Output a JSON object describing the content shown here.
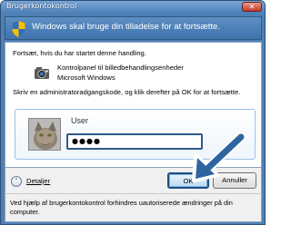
{
  "window": {
    "title": "Brugerkontokontrol",
    "close_glyph": "✕"
  },
  "banner": {
    "text": "Windows skal bruge din tilladelse for at fortsætte."
  },
  "body": {
    "intro": "Fortsæt, hvis du har startet denne handling.",
    "program_name": "Kontrolpanel til billedbehandlingsenheder",
    "publisher": "Microsoft Windows",
    "prompt": "Skriv en administratoradgangskode, og klik derefter på OK for at fortsætte."
  },
  "credential": {
    "user_label": "User",
    "password_value": "●●●●"
  },
  "actions": {
    "details_label": "Detaljer",
    "ok_label": "OK",
    "cancel_label": "Annuller"
  },
  "footer": {
    "text": "Ved hjælp af brugerkontokontrol forhindres uautoriserede ændringer på din computer."
  },
  "colors": {
    "frame": "#4f7fb3",
    "banner": "#3f73ab",
    "highlight_arrow": "#2e64a0",
    "ok_border": "#1d4f82"
  },
  "icons": [
    "shield-icon",
    "control-panel-icon",
    "user-avatar",
    "chevron-down-icon",
    "pointer-arrow"
  ]
}
